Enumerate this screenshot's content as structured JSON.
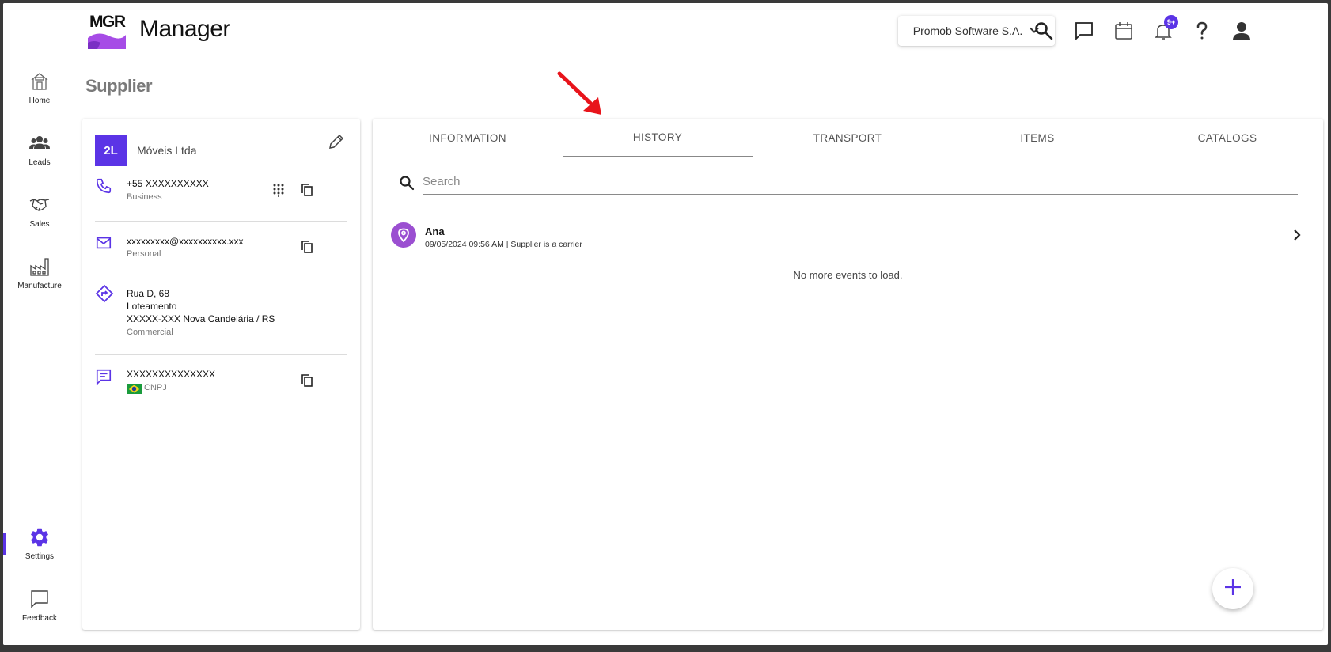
{
  "app": {
    "logo_text": "MGR",
    "title": "Manager"
  },
  "header": {
    "company": "Promob Software S.A.",
    "notification_count": "9+"
  },
  "sidebar": {
    "items": [
      {
        "label": "Home",
        "icon": "home-icon"
      },
      {
        "label": "Leads",
        "icon": "people-icon"
      },
      {
        "label": "Sales",
        "icon": "handshake-icon"
      },
      {
        "label": "Manufacture",
        "icon": "factory-icon"
      },
      {
        "label": "Settings",
        "icon": "gear-icon"
      },
      {
        "label": "Feedback",
        "icon": "chat-icon"
      }
    ],
    "active": "Settings"
  },
  "page": {
    "title": "Supplier"
  },
  "supplier": {
    "initials": "2L",
    "name": "Móveis Ltda",
    "phone": {
      "value": "+55 XXXXXXXXXX",
      "type": "Business"
    },
    "email": {
      "value": "xxxxxxxxx@xxxxxxxxxx.xxx",
      "type": "Personal"
    },
    "address": {
      "line1": "Rua D, 68",
      "line2": "Loteamento",
      "line3": "XXXXX-XXX Nova Candelária / RS",
      "type": "Commercial"
    },
    "document": {
      "value": "XXXXXXXXXXXXXX",
      "type": "CNPJ"
    }
  },
  "tabs": [
    {
      "label": "INFORMATION"
    },
    {
      "label": "HISTORY"
    },
    {
      "label": "TRANSPORT"
    },
    {
      "label": "ITEMS"
    },
    {
      "label": "CATALOGS"
    }
  ],
  "active_tab": "HISTORY",
  "history": {
    "search_placeholder": "Search",
    "events": [
      {
        "name": "Ana",
        "meta": "09/05/2024 09:56 AM | Supplier is a carrier"
      }
    ],
    "end_message": "No more events to load."
  },
  "colors": {
    "accent": "#5b34e6",
    "event_pin": "#9b4fd1",
    "annotation_arrow": "#e8141b"
  }
}
